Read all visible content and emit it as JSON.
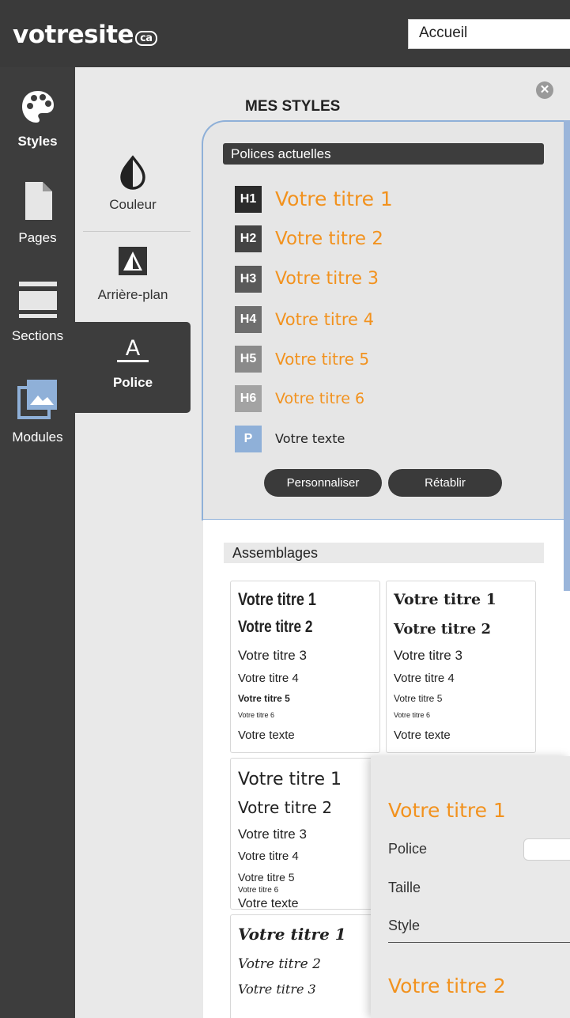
{
  "header": {
    "logo_text": "votresite",
    "logo_tld": "ca",
    "page_select_value": "Accueil"
  },
  "rail": {
    "items": [
      {
        "label": "Styles",
        "icon": "palette-icon",
        "active": true
      },
      {
        "label": "Pages",
        "icon": "page-icon"
      },
      {
        "label": "Sections",
        "icon": "sections-icon"
      },
      {
        "label": "Modules",
        "icon": "image-icon"
      }
    ]
  },
  "panel": {
    "title": "MES STYLES",
    "close_glyph": "✕",
    "subnav": [
      {
        "label": "Couleur",
        "icon": "color-drop-icon"
      },
      {
        "label": "Arrière-plan",
        "icon": "background-icon"
      },
      {
        "label": "Police",
        "icon": "font-icon",
        "glyph": "A",
        "active": true
      }
    ]
  },
  "current_fonts": {
    "header": "Polices actuelles",
    "rows": [
      {
        "badge": "H1",
        "text": "Votre titre 1",
        "badge_color": "#2b2b2b"
      },
      {
        "badge": "H2",
        "text": "Votre titre 2",
        "badge_color": "#444444"
      },
      {
        "badge": "H3",
        "text": "Votre titre 3",
        "badge_color": "#5a5a5a"
      },
      {
        "badge": "H4",
        "text": "Votre titre 4",
        "badge_color": "#6e6e6e"
      },
      {
        "badge": "H5",
        "text": "Votre titre 5",
        "badge_color": "#8a8a8a"
      },
      {
        "badge": "H6",
        "text": "Votre titre 6",
        "badge_color": "#a3a3a3"
      },
      {
        "badge": "P",
        "text": "Votre texte",
        "badge_color": "#8fb0d8"
      }
    ],
    "customize_label": "Personnaliser",
    "reset_label": "Rétablir",
    "accent_color": "#f2921e"
  },
  "assemblages": {
    "header": "Assemblages",
    "cards": [
      {
        "lines": [
          "Votre titre 1",
          "Votre titre 2",
          "Votre titre 3",
          "Votre titre 4",
          "Votre titre 5",
          "Votre titre 6",
          "Votre texte"
        ]
      },
      {
        "lines": [
          "Votre titre 1",
          "Votre titre 2",
          "Votre titre 3",
          "Votre titre 4",
          "Votre titre 5",
          "Votre titre 6",
          "Votre texte"
        ]
      },
      {
        "lines": [
          "Votre titre 1",
          "Votre titre 2",
          "Votre titre 3",
          "Votre titre 4",
          "Votre titre 5",
          "Votre titre 6",
          "Votre texte"
        ]
      },
      {
        "lines": [
          "Votre titre 1",
          "Votre titre 2",
          "Votre titre 3"
        ]
      }
    ]
  },
  "editor": {
    "heading1": "Votre titre 1",
    "police_label": "Police",
    "taille_label": "Taille",
    "style_label": "Style",
    "heading2": "Votre titre 2"
  }
}
